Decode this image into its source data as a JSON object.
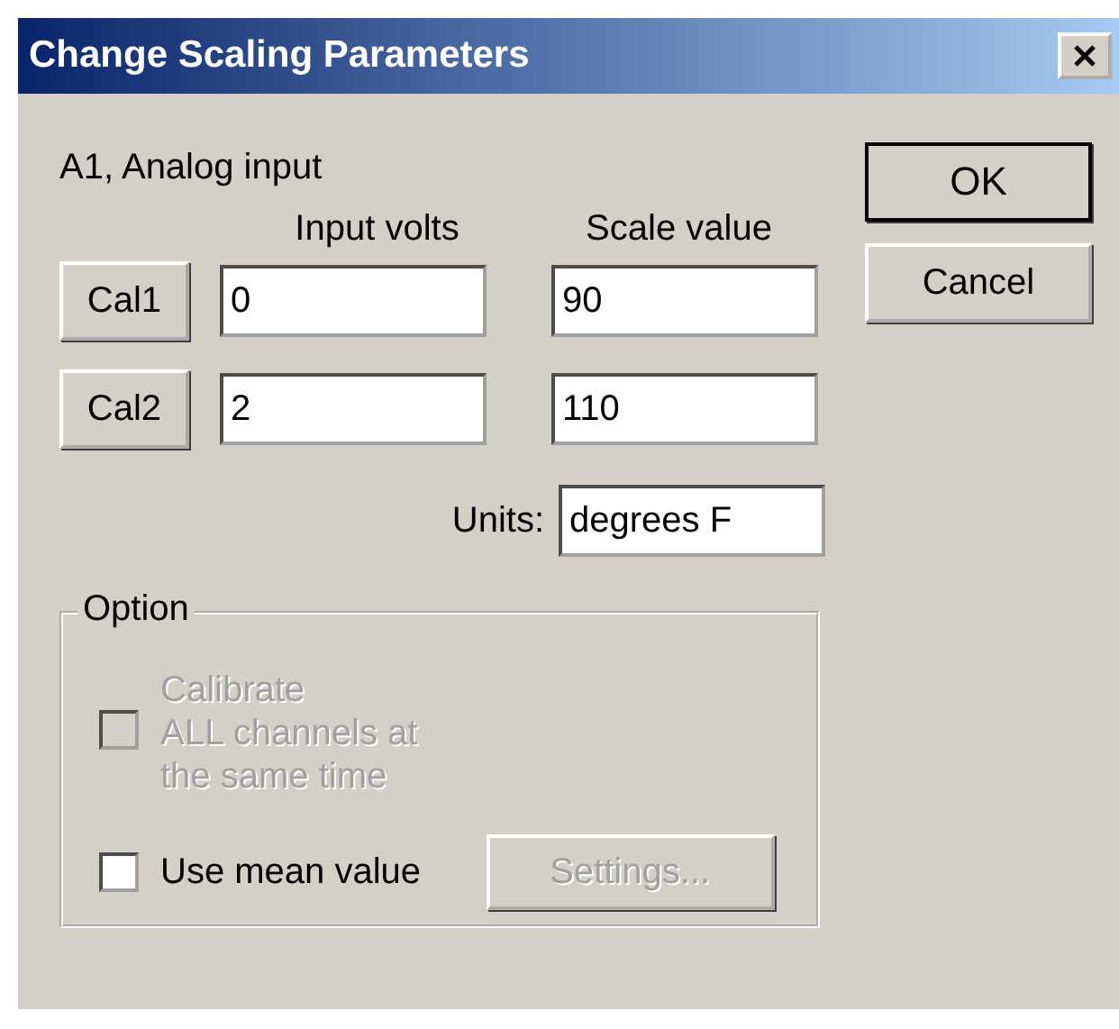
{
  "window": {
    "title": "Change Scaling Parameters"
  },
  "channel_label": "A1, Analog input",
  "columns": [
    "Input volts",
    "Scale value"
  ],
  "rows": [
    {
      "button": "Cal1",
      "input_volts": "0",
      "scale_value": "90"
    },
    {
      "button": "Cal2",
      "input_volts": "2",
      "scale_value": "110"
    }
  ],
  "units": {
    "label": "Units:",
    "value": "degrees F"
  },
  "option_group": {
    "title": "Option",
    "items": [
      {
        "label": "Calibrate\nALL channels at\nthe same time",
        "checked": false,
        "disabled": true
      },
      {
        "label": "Use mean value",
        "checked": false,
        "disabled": false
      }
    ]
  },
  "settings_button": {
    "label": "Settings...",
    "disabled": true
  },
  "buttons": [
    {
      "label": "OK",
      "default": true
    },
    {
      "label": "Cancel",
      "default": false
    }
  ]
}
